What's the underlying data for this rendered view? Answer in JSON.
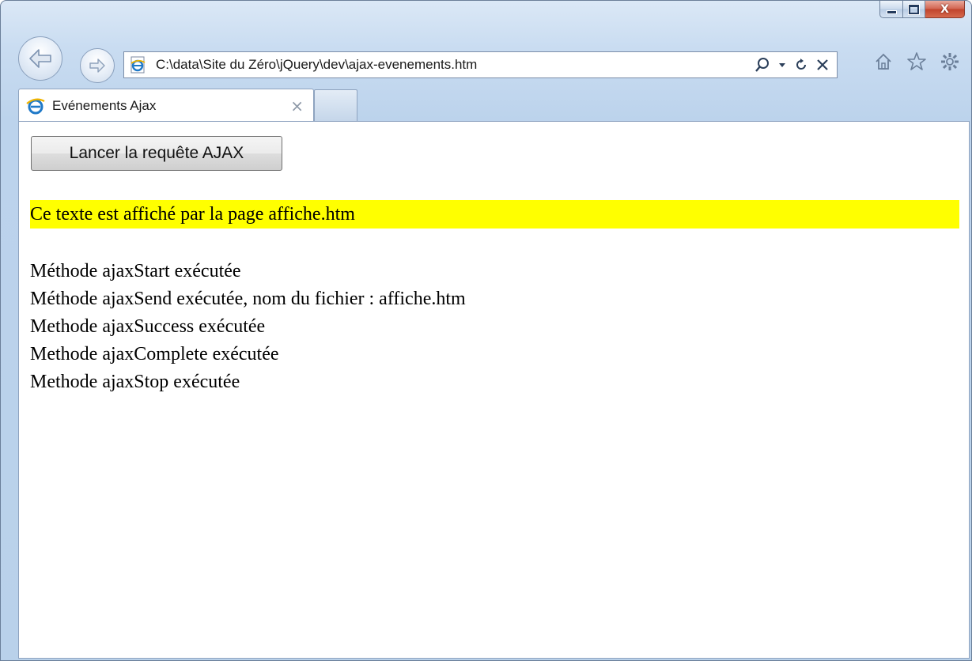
{
  "window": {
    "caption_buttons": [
      "minimize-icon",
      "maximize-icon",
      "close-icon"
    ]
  },
  "nav": {
    "back_icon": "back-arrow-icon",
    "forward_icon": "forward-arrow-icon",
    "address": "C:\\data\\Site du Zéro\\jQuery\\dev\\ajax-evenements.htm",
    "address_tools": [
      "search-icon",
      "dropdown-icon",
      "refresh-icon",
      "stop-icon"
    ],
    "right_tools": [
      "home-icon",
      "favorites-star-icon",
      "settings-gear-icon"
    ]
  },
  "tabs": [
    {
      "title": "Evénements Ajax",
      "close": "×",
      "active": true
    }
  ],
  "page": {
    "button_label": "Lancer la requête AJAX",
    "loaded_text": "Ce texte est affiché par la page affiche.htm",
    "highlight_color": "#ffff00",
    "log": [
      "Méthode ajaxStart exécutée",
      "Méthode ajaxSend exécutée, nom du fichier : affiche.htm",
      "Methode ajaxSuccess exécutée",
      "Methode ajaxComplete exécutée",
      "Methode ajaxStop exécutée"
    ]
  }
}
